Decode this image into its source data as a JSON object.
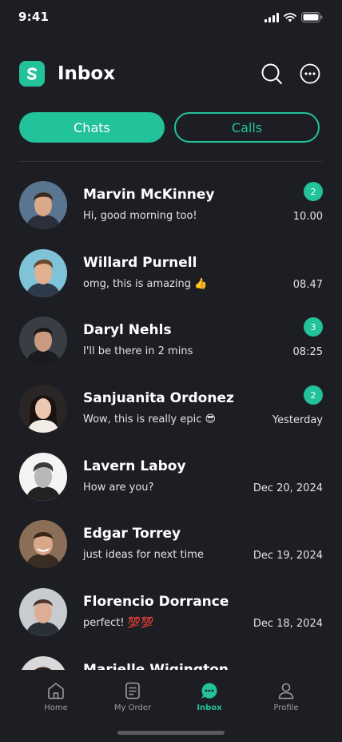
{
  "status_bar": {
    "time": "9:41"
  },
  "header": {
    "title": "Inbox"
  },
  "tabs": [
    {
      "label": "Chats",
      "active": true
    },
    {
      "label": "Calls",
      "active": false
    }
  ],
  "chats": [
    {
      "name": "Marvin McKinney",
      "message": "Hi, good morning too!",
      "time": "10.00",
      "unread": "2"
    },
    {
      "name": "Willard Purnell",
      "message": "omg, this is amazing 👍",
      "time": "08.47",
      "unread": ""
    },
    {
      "name": "Daryl Nehls",
      "message": "I'll be there in 2 mins",
      "time": "08:25",
      "unread": "3"
    },
    {
      "name": "Sanjuanita Ordonez",
      "message": "Wow, this is really epic 😎",
      "time": "Yesterday",
      "unread": "2"
    },
    {
      "name": "Lavern Laboy",
      "message": "How are you?",
      "time": "Dec 20, 2024",
      "unread": ""
    },
    {
      "name": "Edgar Torrey",
      "message": "just ideas for next time",
      "time": "Dec 19, 2024",
      "unread": ""
    },
    {
      "name": "Florencio Dorrance",
      "message": "perfect! 💯💯",
      "time": "Dec 18, 2024",
      "unread": ""
    },
    {
      "name": "Marielle Wigington",
      "message": "",
      "time": "",
      "unread": ""
    }
  ],
  "nav": [
    {
      "label": "Home",
      "icon": "home-icon",
      "active": false
    },
    {
      "label": "My Order",
      "icon": "order-icon",
      "active": false
    },
    {
      "label": "Inbox",
      "icon": "chat-bubble-icon",
      "active": true
    },
    {
      "label": "Profile",
      "icon": "user-icon",
      "active": false
    }
  ],
  "colors": {
    "accent": "#22c29a",
    "background": "#1d1e23",
    "text": "#ffffff",
    "muted": "#9b9ca2"
  }
}
